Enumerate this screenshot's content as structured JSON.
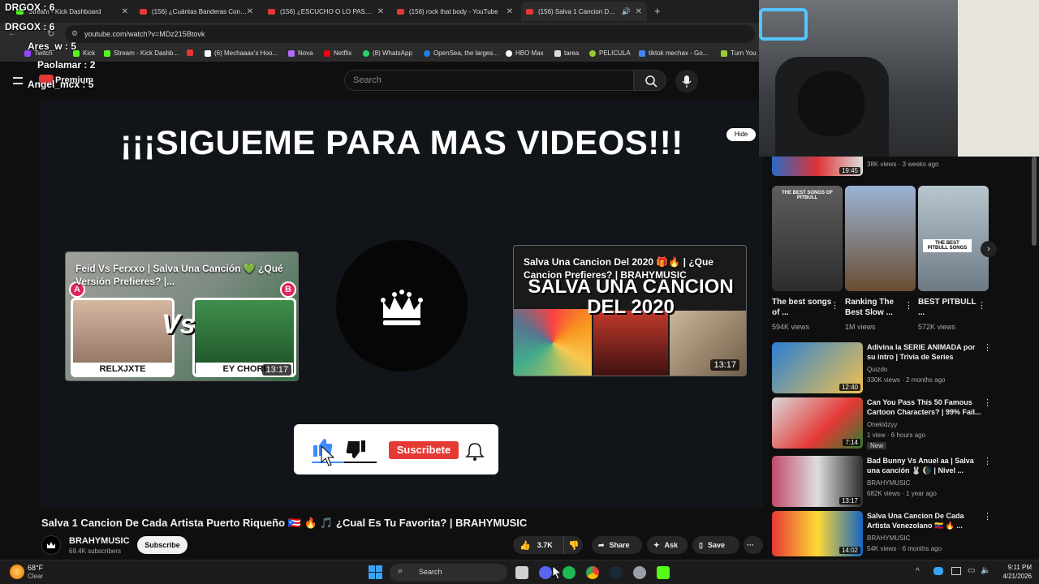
{
  "browser": {
    "tabs": [
      {
        "label": "Stream - Kick Dashboard",
        "active": false
      },
      {
        "label": "(156) ¿Cuántas Banderas Conoces?",
        "active": false
      },
      {
        "label": "(156) ¿ESCUCHO O LO PASO? ¿",
        "active": false
      },
      {
        "label": "(156) rock that body - YouTube",
        "active": false
      },
      {
        "label": "(156) Salva 1 Cancion De Cada",
        "active": true
      }
    ],
    "new_tab": "+",
    "url": "youtube.com/watch?v=MDz215Btovk",
    "bookmarks": [
      "Twitch",
      "Kick",
      "Stream - Kick Dashb...",
      "(6) Mechaaax's Hoo...",
      "Nova",
      "Netflix",
      "(8) WhatsApp",
      "OpenSea, the larges...",
      "HBO Max",
      "tarea",
      "PELICULA",
      "tiktok mechax - Go...",
      "Turn You"
    ]
  },
  "youtube": {
    "premium_label": "Premium",
    "search_placeholder": "Search"
  },
  "player": {
    "endscreen_title": "¡¡¡SIGUEME PARA MAS VIDEOS!!!",
    "hide_label": "Hide",
    "cards": [
      {
        "title": "Feid Vs Ferxxo | Salva Una Canción 💚 ¿Qué Versión Prefieres? |...",
        "duration": "13:17",
        "badge_a": "A",
        "badge_b": "B",
        "vs": "Vs",
        "label_left": "RELXJXTE",
        "label_right": "EY CHORI"
      },
      {
        "title": "Salva Una Cancion Del 2020 🎁🔥 | ¿Que Cancion Prefieres? | BRAHYMUSIC",
        "duration": "13:17",
        "big_text": "SALVA UNA CANCION DEL 2020"
      }
    ],
    "subscribe_widget_label": "Suscribete"
  },
  "video": {
    "title": "Salva 1 Cancion De Cada Artista Puerto Riqueño 🇵🇷 🔥 🎵 ¿Cual Es Tu Favorita? | BRAHYMUSIC",
    "channel": "BRAHYMUSIC",
    "subscribers": "69.4K subscribers",
    "subscribe_label": "Subscribe",
    "likes": "3.7K",
    "share_label": "Share",
    "ask_label": "Ask",
    "save_label": "Save",
    "more_label": "···"
  },
  "sidebar": {
    "top_partial": {
      "meta": "38K views · 3 weeks ago",
      "duration": "19:45"
    },
    "shorts": [
      {
        "title": "The best songs of ...",
        "views": "594K views",
        "thumb_text": "THE BEST SONGS OF PITBULL"
      },
      {
        "title": "Ranking The Best Slow ...",
        "views": "1M views",
        "thumb_text": ""
      },
      {
        "title": "BEST PITBULL ...",
        "views": "572K views",
        "thumb_text": "THE BEST PITBULL SONGS"
      }
    ],
    "recommendations": [
      {
        "title": "Adivina la SERIE ANIMADA por su intro | Trivia de Series",
        "channel": "Quizdo",
        "meta": "330K views · 2 months ago",
        "duration": "12:40",
        "badge": ""
      },
      {
        "title": "Can You Pass This 50 Famous Cartoon Characters? | 99% Fail...",
        "channel": "Onekidzyy",
        "meta": "1 view · 6 hours ago",
        "duration": "7:14",
        "badge": "New"
      },
      {
        "title": "Bad Bunny Vs Anuel aa | Salva una canción 🐰 🌘 | Nivel ...",
        "channel": "BRAHYMUSIC",
        "meta": "682K views · 1 year ago",
        "duration": "13:17",
        "badge": ""
      },
      {
        "title": "Salva Una Cancion De Cada Artista Venezolano 🇻🇪 🔥 ...",
        "channel": "BRAHYMUSIC",
        "meta": "54K views · 6 months ago",
        "duration": "14:02",
        "badge": ""
      }
    ]
  },
  "stream_overlay": {
    "chat": [
      {
        "user": "DRGOX",
        "count": "6"
      },
      {
        "user": "DRGOX",
        "count": "6"
      },
      {
        "user": "Ares_w",
        "count": "5"
      },
      {
        "user": "Paolamar",
        "count": "2"
      },
      {
        "user": "Angel_mcx",
        "count": "5"
      }
    ]
  },
  "taskbar": {
    "weather_temp": "68°F",
    "weather_desc": "Clear",
    "search_label": "Search",
    "time": "9:11 PM",
    "date": "4/21/2026"
  },
  "colors": {
    "accent_red": "#e53935",
    "kick_green": "#53fc18",
    "bg": "#0f0f0f"
  }
}
